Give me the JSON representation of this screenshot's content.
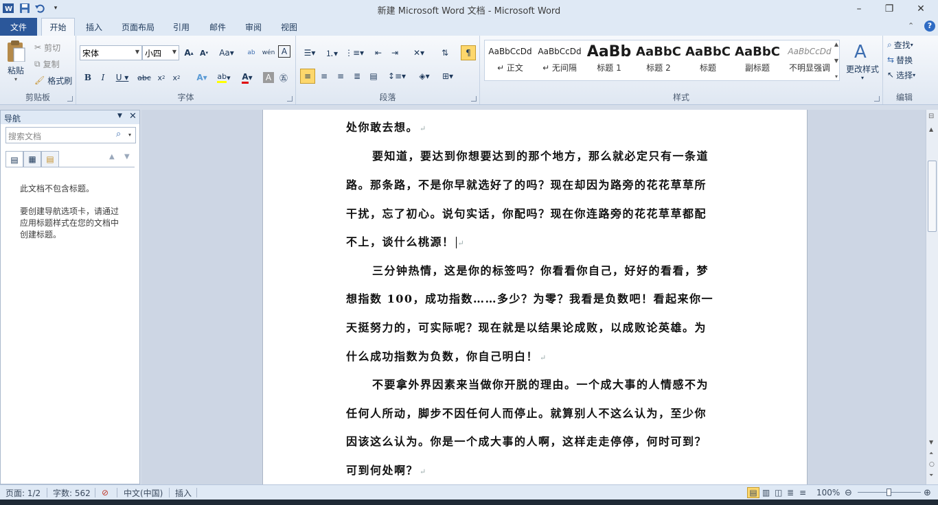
{
  "window": {
    "title": "新建 Microsoft Word 文档 - Microsoft Word",
    "minimize": "–",
    "maximize": "❐",
    "close": "✕"
  },
  "tabs": [
    {
      "label": "文件"
    },
    {
      "label": "开始"
    },
    {
      "label": "插入"
    },
    {
      "label": "页面布局"
    },
    {
      "label": "引用"
    },
    {
      "label": "邮件"
    },
    {
      "label": "审阅"
    },
    {
      "label": "视图"
    }
  ],
  "ribbon": {
    "clipboard": {
      "paste": "粘贴",
      "cut": "剪切",
      "copy": "复制",
      "format_painter": "格式刷",
      "label": "剪贴板"
    },
    "font": {
      "name": "宋体",
      "size": "小四",
      "label": "字体"
    },
    "paragraph": {
      "label": "段落"
    },
    "styles": {
      "label": "样式",
      "items": [
        {
          "sample": "AaBbCcDd",
          "name": "↵ 正文"
        },
        {
          "sample": "AaBbCcDd",
          "name": "↵ 无间隔"
        },
        {
          "sample": "AaBb",
          "name": "标题 1"
        },
        {
          "sample": "AaBbC",
          "name": "标题 2"
        },
        {
          "sample": "AaBbC",
          "name": "标题"
        },
        {
          "sample": "AaBbC",
          "name": "副标题"
        },
        {
          "sample": "AaBbCcDd",
          "name": "不明显强调"
        }
      ],
      "change_styles": "更改样式"
    },
    "editing": {
      "find": "查找",
      "replace": "替换",
      "select": "选择",
      "label": "编辑"
    }
  },
  "nav": {
    "title": "导航",
    "search_placeholder": "搜索文档",
    "no_headings": "此文档不包含标题。",
    "hint": [
      "要创建导航选项卡，请通过",
      "应用标题样式在您的文档中",
      "创建标题。"
    ]
  },
  "document": {
    "lines": [
      "处你敢去想。",
      "要知道，要达到你想要达到的那个地方，那么就必定只有一条道",
      "路。那条路，不是你早就选好了的吗？现在却因为路旁的花花草草所",
      "干扰，忘了初心。说句实话，你配吗？现在你连路旁的花花草草都配",
      "不上，谈什么桃源！",
      "三分钟热情，这是你的标签吗？你看看你自己，好好的看看，梦",
      "想指数 100，成功指数……多少？为零？我看是负数吧！看起来你一",
      "天挺努力的，可实际呢？现在就是以结果论成败，以成败论英雄。为",
      "什么成功指数为负数，你自己明白！",
      "不要拿外界因素来当做你开脱的理由。一个成大事的人情感不为",
      "任何人所动，脚步不因任何人而停止。就算别人不这么认为，至少你",
      "因该这么认为。你是一个成大事的人啊，这样走走停停，何时可到？",
      "可到何处啊？"
    ]
  },
  "status": {
    "page": "页面: 1/2",
    "words": "字数: 562",
    "language": "中文(中国)",
    "mode": "插入",
    "zoom": "100%"
  },
  "colors": {
    "accent": "#2b579a",
    "highlight_button": "#fdd76c"
  }
}
